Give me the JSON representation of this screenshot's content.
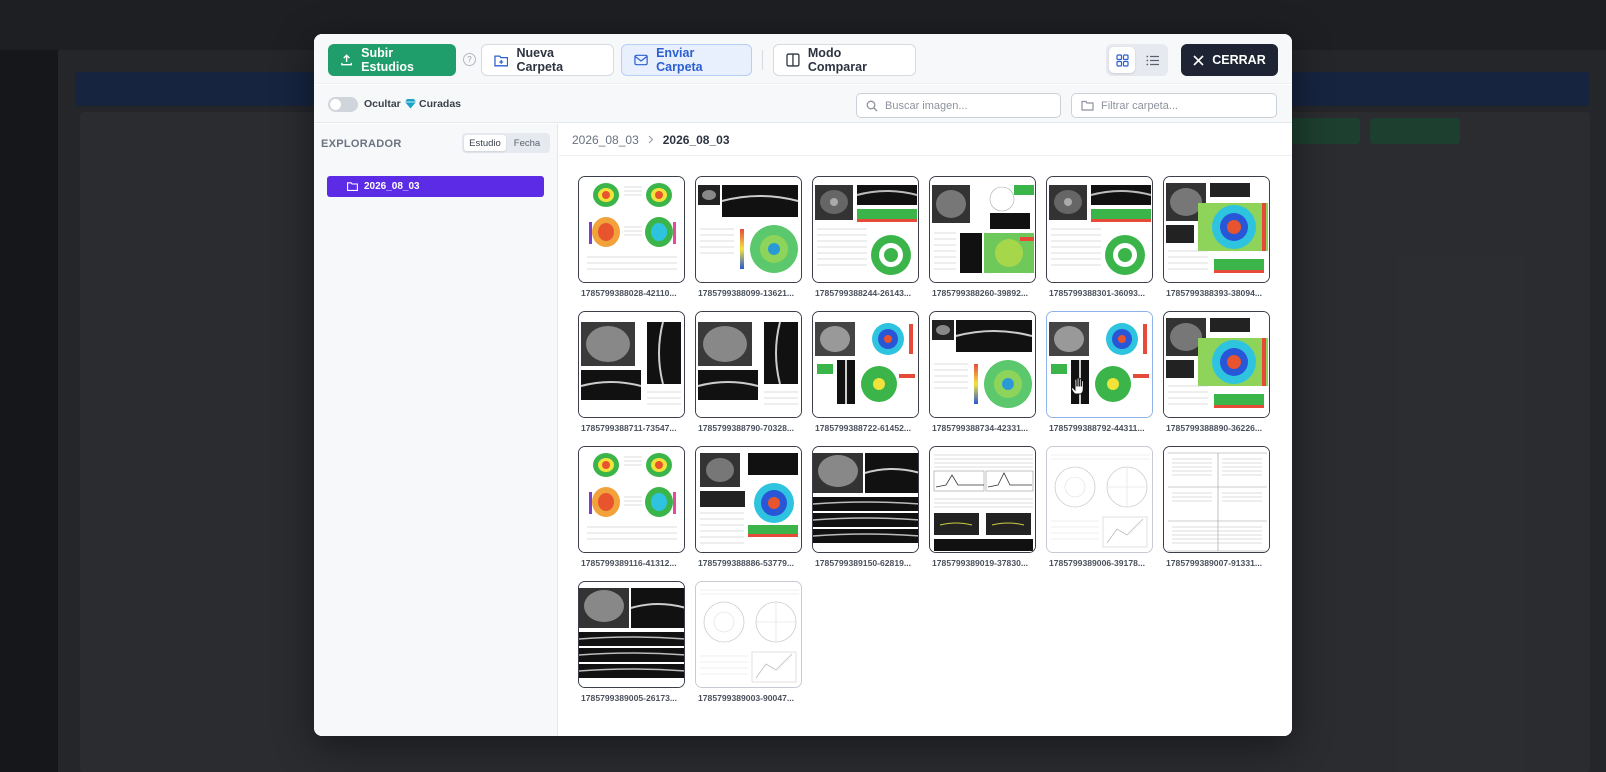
{
  "toolbar": {
    "upload_label": "Subir Estudios",
    "new_folder_label": "Nueva Carpeta",
    "send_folder_label": "Enviar Carpeta",
    "compare_label": "Modo Comparar",
    "close_label": "CERRAR"
  },
  "filters": {
    "hide_label": "Ocultar",
    "curated_label": "Curadas",
    "search_placeholder": "Buscar imagen...",
    "folder_placeholder": "Filtrar carpeta..."
  },
  "sidebar": {
    "title": "EXPLORADOR",
    "seg_study": "Estudio",
    "seg_date": "Fecha",
    "folders": [
      {
        "label": "2026_08_03",
        "selected": true
      }
    ]
  },
  "breadcrumb": {
    "root": "2026_08_03",
    "current": "2026_08_03"
  },
  "colors": {
    "upload": "#1f9d6b",
    "send": "#2c5fd0",
    "close": "#1e2433",
    "folder_selected": "#5b2be6"
  },
  "images": [
    {
      "name": "1785799388028-42110...",
      "style": "topo"
    },
    {
      "name": "1785799388099-13621...",
      "style": "field"
    },
    {
      "name": "1785799388244-26143...",
      "style": "oct"
    },
    {
      "name": "1785799388260-39892...",
      "style": "report"
    },
    {
      "name": "1785799388301-36093...",
      "style": "oct"
    },
    {
      "name": "1785799388393-38094...",
      "style": "map"
    },
    {
      "name": "1785799388711-73547...",
      "style": "bscan"
    },
    {
      "name": "1785799388790-70328...",
      "style": "bscan"
    },
    {
      "name": "1785799388722-61452...",
      "style": "dual"
    },
    {
      "name": "1785799388734-42331...",
      "style": "field"
    },
    {
      "name": "1785799388792-44311...",
      "style": "dual",
      "hover": true
    },
    {
      "name": "1785799388890-36226...",
      "style": "map"
    },
    {
      "name": "1785799389116-41312...",
      "style": "topo"
    },
    {
      "name": "1785799388886-53779...",
      "style": "map2"
    },
    {
      "name": "1785799389150-62819...",
      "style": "scans"
    },
    {
      "name": "1785799389019-37830...",
      "style": "graph"
    },
    {
      "name": "1785799389006-39178...",
      "style": "faint"
    },
    {
      "name": "1785799389007-91331...",
      "style": "table"
    },
    {
      "name": "1785799389005-26173...",
      "style": "scans"
    },
    {
      "name": "1785799389003-90047...",
      "style": "faint"
    }
  ]
}
